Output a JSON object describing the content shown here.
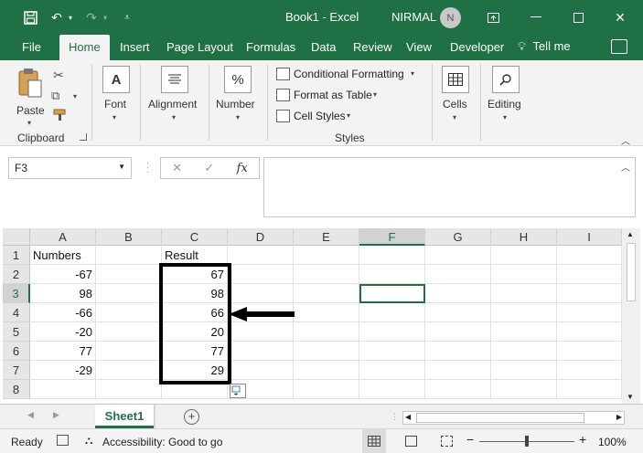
{
  "titlebar": {
    "title": "Book1  -  Excel",
    "user": "NIRMAL",
    "avatar_initial": "N",
    "icons": [
      "save-icon",
      "undo-icon",
      "redo-icon",
      "customize-icon",
      "restore-ribbon-icon",
      "minimize-icon",
      "maximize-icon",
      "close-icon"
    ]
  },
  "tabs": [
    "File",
    "Home",
    "Insert",
    "Page Layout",
    "Formulas",
    "Data",
    "Review",
    "View",
    "Developer"
  ],
  "tell_me": "Tell me",
  "ribbon": {
    "clipboard": {
      "paste": "Paste",
      "group": "Clipboard"
    },
    "font": "Font",
    "alignment": "Alignment",
    "number": "Number",
    "styles": {
      "conditional": "Conditional Formatting",
      "format_table": "Format as Table",
      "cell_styles": "Cell Styles",
      "group": "Styles"
    },
    "cells": "Cells",
    "editing": "Editing"
  },
  "formula_bar": {
    "name_box": "F3",
    "cancel": "✕",
    "enter": "✓",
    "fx": "fx",
    "value": ""
  },
  "columns": [
    "A",
    "B",
    "C",
    "D",
    "E",
    "F",
    "G",
    "H",
    "I"
  ],
  "rows": [
    "1",
    "2",
    "3",
    "4",
    "5",
    "6",
    "7",
    "8"
  ],
  "cells": {
    "A1": "Numbers",
    "C1": "Result",
    "A2": "-67",
    "C2": "67",
    "A3": "98",
    "C3": "98",
    "A4": "-66",
    "C4": "66",
    "A5": "-20",
    "C5": "20",
    "A6": "77",
    "C6": "77",
    "A7": "-29",
    "C7": "29"
  },
  "active_cell": "F3",
  "sheets": [
    "Sheet1"
  ],
  "status": {
    "ready": "Ready",
    "accessibility": "Accessibility: Good to go",
    "zoom": "100%"
  },
  "colors": {
    "accent": "#1f7145"
  }
}
